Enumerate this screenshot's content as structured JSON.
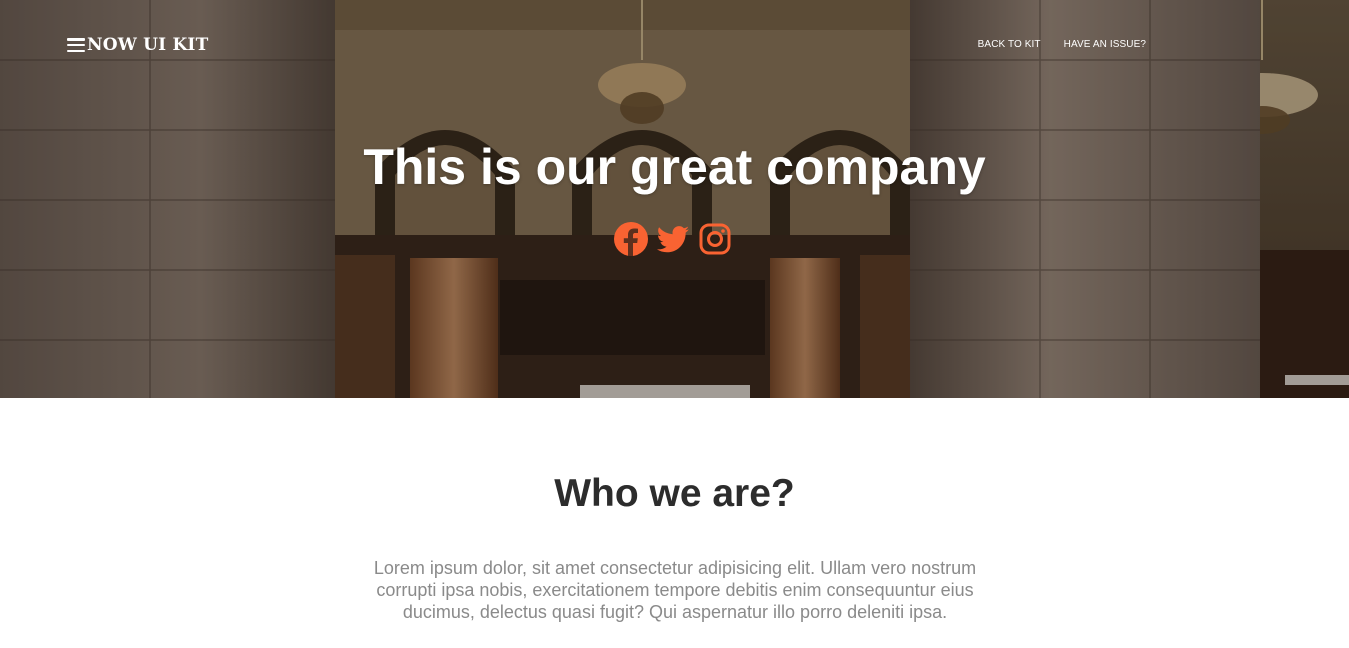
{
  "navbar": {
    "brand": "NOW UI KIT",
    "links": [
      "BACK TO KIT",
      "HAVE AN ISSUE?"
    ]
  },
  "hero": {
    "title": "This is our great company",
    "socials": [
      "facebook-icon",
      "twitter-icon",
      "instagram-icon"
    ],
    "accent_color": "#f96332"
  },
  "about": {
    "title": "Who we are?",
    "description": "Lorem ipsum dolor, sit amet consectetur adipisicing elit. Ullam vero nostrum corrupti ipsa nobis, exercitationem tempore debitis enim consequuntur eius ducimus, delectus quasi fugit? Qui aspernatur illo porro deleniti ipsa."
  }
}
